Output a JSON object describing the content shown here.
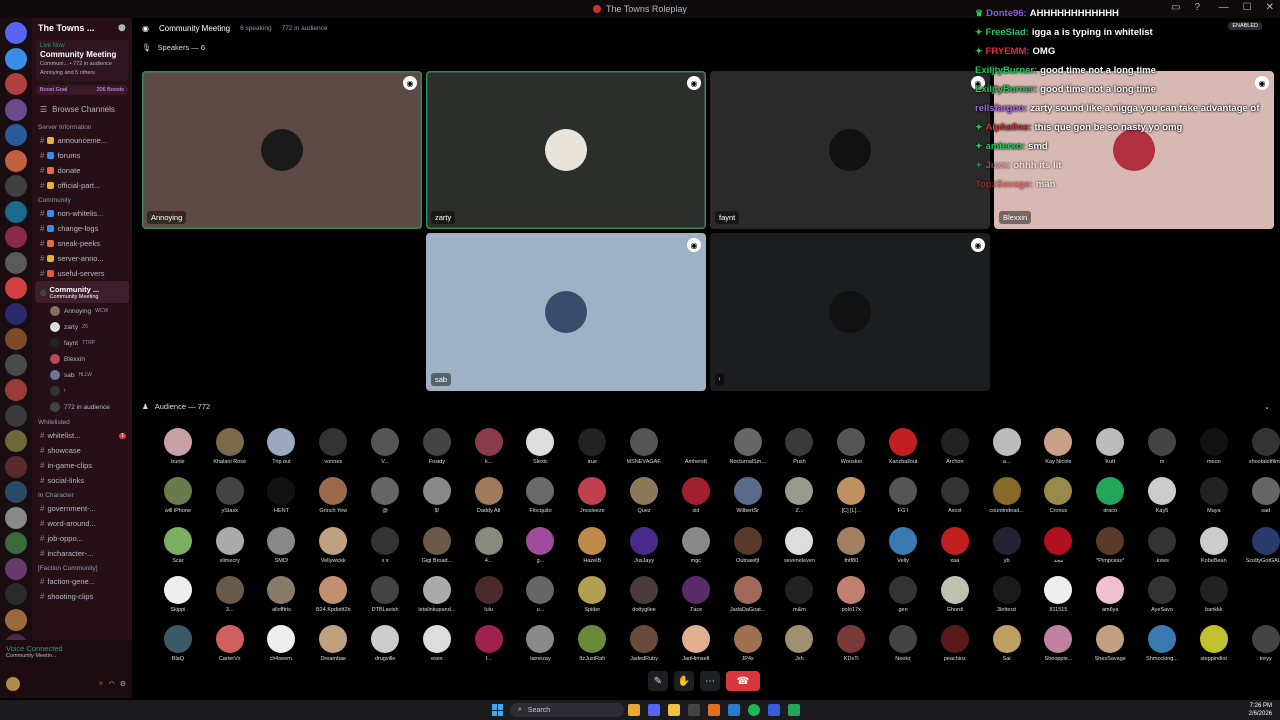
{
  "window": {
    "title": "The Towns Roleplay"
  },
  "server": {
    "name": "The Towns ...",
    "boost_goal": "Boost Goal",
    "boosts": "206 Boosts"
  },
  "live_card": {
    "live": "Live Now",
    "title": "Community Meeting",
    "line1": "Communi... • 772 in audience",
    "line2": "Annoying and 5 others"
  },
  "browse": "Browse Channels",
  "categories": [
    {
      "label": "Server Information",
      "channels": [
        {
          "name": "announceme...",
          "color": "#e8b13a"
        },
        {
          "name": "forums",
          "color": "#3a8ee8"
        },
        {
          "name": "donate",
          "color": "#e0703a"
        },
        {
          "name": "official-part...",
          "color": "#e8b13a"
        }
      ]
    },
    {
      "label": "Community",
      "channels": [
        {
          "name": "non-whitelis...",
          "color": "#3a8ee8"
        },
        {
          "name": "change-logs",
          "color": "#3a8ee8"
        },
        {
          "name": "sneak-peeks",
          "color": "#e0703a"
        },
        {
          "name": "server-anno...",
          "color": "#e8b13a"
        },
        {
          "name": "useful-servers",
          "color": "#e05a3a"
        }
      ]
    }
  ],
  "active_channel": {
    "name": "Community ...",
    "sub": "Community Meeting"
  },
  "voice_users": [
    {
      "name": "Annoying",
      "tag": "WCW",
      "color": "#8a6e6a"
    },
    {
      "name": "zarty",
      "tag": "Z6",
      "color": "#ddd"
    },
    {
      "name": "faynt",
      "tag": "TTRP",
      "color": "#222"
    },
    {
      "name": "Blexxin",
      "tag": "",
      "color": "#b84a5a"
    },
    {
      "name": "sab",
      "tag": "HLLW",
      "color": "#6a7a9a"
    },
    {
      "name": "ᶦ",
      "tag": "",
      "color": "#333"
    },
    {
      "name": "772 in audience",
      "tag": "",
      "color": "#444"
    }
  ],
  "categories2": [
    {
      "label": "Whitelisted",
      "channels": [
        {
          "name": "whitelist...",
          "count": "1"
        },
        {
          "name": "showcase",
          "count": ""
        },
        {
          "name": "in-game-clips",
          "count": ""
        },
        {
          "name": "social-links",
          "count": ""
        }
      ]
    },
    {
      "label": "In Character",
      "channels": [
        {
          "name": "government-...",
          "count": ""
        },
        {
          "name": "word-around...",
          "count": ""
        },
        {
          "name": "job-oppo...",
          "count": ""
        },
        {
          "name": "incharacter-...",
          "count": ""
        }
      ]
    },
    {
      "label": "[Faction Community]",
      "channels": [
        {
          "name": "faction-gene...",
          "count": ""
        },
        {
          "name": "shooting-clips",
          "count": ""
        }
      ]
    }
  ],
  "voice_status": {
    "title": "Voice Connected",
    "sub": "Community Meetin..."
  },
  "stage": {
    "title": "Community Meeting",
    "speaking": "6 speaking",
    "audience_meta": "772 in audience",
    "speakers_label": "Speakers — 6",
    "audience_label": "Audience — 772"
  },
  "speakers": [
    {
      "name": "Annoying",
      "bg": "#5e4a45",
      "av": "#1a1a1a"
    },
    {
      "name": "zarty",
      "bg": "#2c2e2b",
      "av": "#e8e4da"
    },
    {
      "name": "faynt",
      "bg": "#2a2a2a",
      "av": "#111"
    },
    {
      "name": "Blexxin",
      "bg": "#d8b8b3",
      "av": "#b03040"
    },
    {
      "name": "sab",
      "bg": "#9fb1c4",
      "av": "#3a4c6c"
    },
    {
      "name": "ᶦ",
      "bg": "#1c1d1f",
      "av": "#111"
    }
  ],
  "audience": [
    {
      "n": "bunie",
      "c": "#c9a0a6"
    },
    {
      "n": "Khalani Rose",
      "c": "#7a6a4a"
    },
    {
      "n": "Trip out",
      "c": "#9aa8c0"
    },
    {
      "n": "vonoes",
      "c": "#333"
    },
    {
      "n": "V...",
      "c": "#555"
    },
    {
      "n": "Fosidy",
      "c": "#444"
    },
    {
      "n": "k...",
      "c": "#8a3a4a"
    },
    {
      "n": "Slexic",
      "c": "#ddd"
    },
    {
      "n": "true",
      "c": "#222"
    },
    {
      "n": "MSNEVAGAF.",
      "c": "#555"
    },
    {
      "n": "Amherstt",
      "c": "#000"
    },
    {
      "n": "NocturnalSm...",
      "c": "#666"
    },
    {
      "n": "Push",
      "c": "#3a3a3a"
    },
    {
      "n": "Wooskei",
      "c": "#555"
    },
    {
      "n": "Xanzballout",
      "c": "#c02020"
    },
    {
      "n": "Archon",
      "c": "#222"
    },
    {
      "n": "a...",
      "c": "#bbb"
    },
    {
      "n": "Kay Nicole",
      "c": "#c9a088"
    },
    {
      "n": "Kutt",
      "c": "#bbb"
    },
    {
      "n": "m",
      "c": "#444"
    },
    {
      "n": "moon",
      "c": "#111"
    },
    {
      "n": "shootalotfilms",
      "c": "#333"
    },
    {
      "n": "will iPhone",
      "c": "#6a7a4a"
    },
    {
      "n": "yStaxx",
      "c": "#444"
    },
    {
      "n": "HENT",
      "c": "#111"
    },
    {
      "n": "Grinch Yew",
      "c": "#9a6a4a"
    },
    {
      "n": "@",
      "c": "#666"
    },
    {
      "n": "$!",
      "c": "#888"
    },
    {
      "n": "Daddy Alt",
      "c": "#a07a5a"
    },
    {
      "n": "Flocquito",
      "c": "#6a6a6a"
    },
    {
      "n": "Jnosleeze",
      "c": "#c04050"
    },
    {
      "n": "Quez",
      "c": "#8a7a5a"
    },
    {
      "n": "sid",
      "c": "#a02030"
    },
    {
      "n": "WilbertSr",
      "c": "#5a6a8a"
    },
    {
      "n": "Z...",
      "c": "#9a9a8a"
    },
    {
      "n": "[C] [L]...",
      "c": "#c09060"
    },
    {
      "n": "FG I",
      "c": "#555"
    },
    {
      "n": "Axcst",
      "c": "#333"
    },
    {
      "n": "countindead...",
      "c": "#8a6a2a"
    },
    {
      "n": "Cronus",
      "c": "#9a8a4a"
    },
    {
      "n": "draco",
      "c": "#23a55a"
    },
    {
      "n": "Kay5",
      "c": "#ccc"
    },
    {
      "n": "Maya",
      "c": "#222"
    },
    {
      "n": "sad",
      "c": "#666"
    },
    {
      "n": "Scar",
      "c": "#7ab060"
    },
    {
      "n": "slimecry",
      "c": "#aaa"
    },
    {
      "n": "SMD!",
      "c": "#888"
    },
    {
      "n": "Vellywickk",
      "c": "#c0a080"
    },
    {
      "n": "x x",
      "c": "#333"
    },
    {
      "n": "Gigi Broad...",
      "c": "#6a5a4a"
    },
    {
      "n": "4...",
      "c": "#8a8a7a"
    },
    {
      "n": "g...",
      "c": "#a04a9a"
    },
    {
      "n": "HazelB",
      "c": "#c08a4a"
    },
    {
      "n": "JusJayy",
      "c": "#4a2a8a"
    },
    {
      "n": "mgc",
      "c": "#888"
    },
    {
      "n": "Outnawfjt",
      "c": "#5a3a2a"
    },
    {
      "n": "seveneleven",
      "c": "#ddd"
    },
    {
      "n": "thtf80",
      "c": "#a08060"
    },
    {
      "n": "Velly",
      "c": "#3a7ab0"
    },
    {
      "n": "xaa",
      "c": "#c02020"
    },
    {
      "n": "yb",
      "c": "#223"
    },
    {
      "n": "مجد",
      "c": "#b01020"
    },
    {
      "n": "*Pimpcess*",
      "c": "#5a3a2a"
    },
    {
      "n": ".kxws",
      "c": "#333"
    },
    {
      "n": "KobeBean",
      "c": "#ccc"
    },
    {
      "n": "ScottyGotGAL...",
      "c": "#2a3a6a"
    },
    {
      "n": "Skippi",
      "c": "#eee"
    },
    {
      "n": "3...",
      "c": "#6a5a4a"
    },
    {
      "n": "allofftris",
      "c": "#8a7a6a"
    },
    {
      "n": "B24.Kpdoitt2b",
      "c": "#c09070"
    },
    {
      "n": "DTBLavish",
      "c": "#444"
    },
    {
      "n": "letalinkupand...",
      "c": "#aaa"
    },
    {
      "n": "lulu",
      "c": "#4a2a2a"
    },
    {
      "n": "u...",
      "c": "#666"
    },
    {
      "n": "Spider",
      "c": "#b0a050"
    },
    {
      "n": "dottygilee",
      "c": "#4a3a3a"
    },
    {
      "n": "J'ace",
      "c": "#5a2a6a"
    },
    {
      "n": "JadaDaGoat...",
      "c": "#a06a5a"
    },
    {
      "n": "m&m",
      "c": "#222"
    },
    {
      "n": "polo17x",
      "c": "#c08070"
    },
    {
      "n": "gen",
      "c": "#333"
    },
    {
      "n": "Ghordi",
      "c": "#c0c0b0"
    },
    {
      "n": "3letterzi",
      "c": "#1a1a1a"
    },
    {
      "n": "811515",
      "c": "#eee"
    },
    {
      "n": "am6ya",
      "c": "#f0c0d0"
    },
    {
      "n": "AyeSavo",
      "c": "#333"
    },
    {
      "n": "bankkk",
      "c": "#222"
    },
    {
      "n": "",
      "c": "#000"
    },
    {
      "n": "BlaQ",
      "c": "#3a5a6a"
    },
    {
      "n": "CarterVx",
      "c": "#d06060"
    },
    {
      "n": "ch4seem.",
      "c": "#eee"
    },
    {
      "n": "Dreambae",
      "c": "#c0a080"
    },
    {
      "n": "drugville",
      "c": "#ccc"
    },
    {
      "n": "esex",
      "c": "#ddd"
    },
    {
      "n": "f...",
      "c": "#a02050"
    },
    {
      "n": "lamezay",
      "c": "#8a8a8a"
    },
    {
      "n": "ItzJustRah",
      "c": "#6a8a3a"
    },
    {
      "n": "JadedRuby",
      "c": "#6a4a3a"
    },
    {
      "n": "JariHimself",
      "c": "#e0b090"
    },
    {
      "n": "JP4s",
      "c": "#a07050"
    },
    {
      "n": "Jsh",
      "c": "#a09070"
    },
    {
      "n": "KDxTi",
      "c": "#7a3a3a"
    },
    {
      "n": "Neekz",
      "c": "#444"
    },
    {
      "n": "peachioz",
      "c": "#5a1a1a"
    },
    {
      "n": "Sai",
      "c": "#c0a060"
    },
    {
      "n": "Sheoppie...",
      "c": "#c080a0"
    },
    {
      "n": "ShesSavage",
      "c": "#c0a080"
    },
    {
      "n": "Shmocking...",
      "c": "#3a7ab0"
    },
    {
      "n": "steppindior",
      "c": "#c0c030"
    },
    {
      "n": "treyy",
      "c": "#444"
    }
  ],
  "chat": [
    {
      "icon": "♛",
      "user": "Donte96:",
      "ucolor": "#8a5ae0",
      "text": "AHHHHHHHHHHHH"
    },
    {
      "icon": "✦",
      "user": "FreeSlad:",
      "ucolor": "#23c55a",
      "text": "igga a is typing in whitelist"
    },
    {
      "icon": "✦",
      "user": "FRYEMM:",
      "ucolor": "#e03030",
      "text": "OMG"
    },
    {
      "icon": "",
      "user": "ExiljtyBurner:",
      "ucolor": "#23c55a",
      "text": "good time not a long time"
    },
    {
      "icon": "",
      "user": "ExiljtyBurner:",
      "ucolor": "#23c55a",
      "text": "good time not a long time"
    },
    {
      "icon": "",
      "user": "rellsfargoo:",
      "ucolor": "#a06ae0",
      "text": "zarty sound like a nigga you can take advantage of"
    },
    {
      "icon": "✦",
      "user": "Alpha0ne:",
      "ucolor": "#e03030",
      "text": "this que gon be so nasty yo omg"
    },
    {
      "icon": "✦",
      "user": "amierxo:",
      "ucolor": "#23c55a",
      "text": "smd"
    },
    {
      "icon": "✦",
      "user": "Juxx:",
      "ucolor": "#e06a8a",
      "text": "ohhh its lit"
    },
    {
      "icon": "",
      "user": "TopzSavage:",
      "ucolor": "#e03030",
      "text": "man"
    }
  ],
  "chat_status": "ENABLED",
  "taskbar": {
    "search": "Search",
    "time": "7:26 PM",
    "date": "2/6/2026"
  }
}
